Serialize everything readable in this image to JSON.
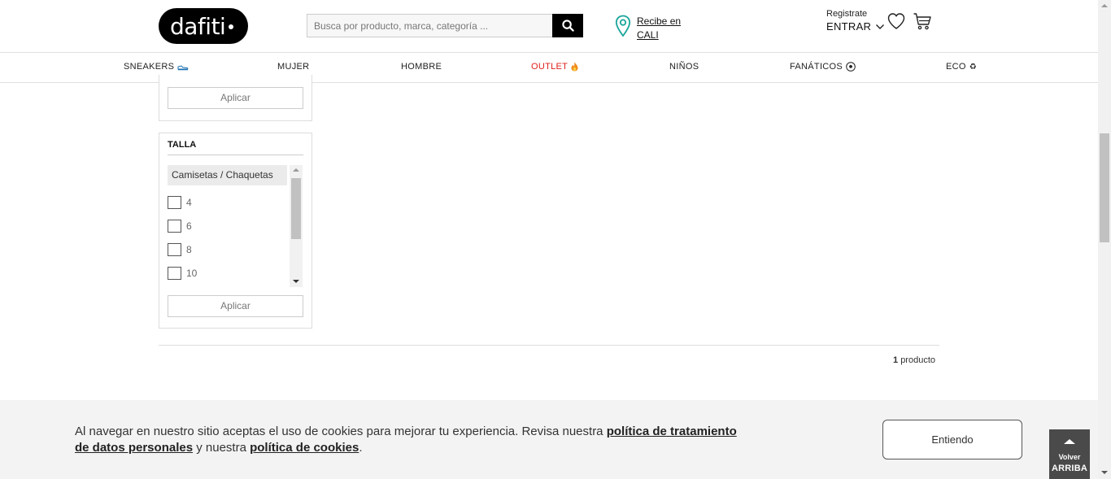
{
  "header": {
    "logo_text": "dafiti",
    "search": {
      "placeholder": "Busca por producto, marca, categoría ..."
    },
    "location": {
      "line1": "Recibe en",
      "line2": "CALI"
    },
    "account": {
      "register": "Registrate",
      "login": "ENTRAR"
    }
  },
  "nav": {
    "items": [
      {
        "label": "SNEAKERS",
        "icon": "sneaker-icon"
      },
      {
        "label": "MUJER"
      },
      {
        "label": "HOMBRE"
      },
      {
        "label": "OUTLET",
        "icon": "fire-icon",
        "color": "#e0201c"
      },
      {
        "label": "NIÑOS"
      },
      {
        "label": "FANÁTICOS",
        "icon": "soccer-ball-icon"
      },
      {
        "label": "ECO",
        "icon": "recycle-icon"
      }
    ]
  },
  "filters": {
    "apply_label": "Aplicar",
    "size": {
      "title": "TALLA",
      "group": "Camisetas / Chaquetas",
      "options": [
        "4",
        "6",
        "8",
        "10"
      ],
      "apply_label": "Aplicar"
    }
  },
  "results": {
    "count": "1",
    "count_label": "producto"
  },
  "cookie": {
    "text_before": "Al navegar en nuestro sitio aceptas el uso de cookies para mejorar tu experiencia. Revisa nuestra ",
    "link1": "política de tratamiento de datos personales",
    "text_middle": " y nuestra ",
    "link2": "política de cookies",
    "text_after": ".",
    "button": "Entiendo"
  },
  "back_to_top": {
    "line1": "Volver",
    "line2": "ARRIBA"
  }
}
